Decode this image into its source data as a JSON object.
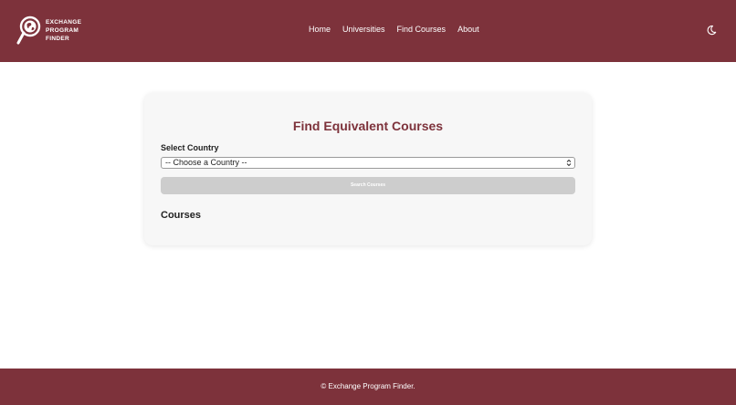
{
  "header": {
    "logo_lines": [
      "EXCHANGE",
      "PROGRAM",
      "FINDER"
    ],
    "nav": [
      "Home",
      "Universities",
      "Find Courses",
      "About"
    ],
    "theme_icon": "moon-icon"
  },
  "main": {
    "title": "Find Equivalent Courses",
    "country_label": "Select Country",
    "country_select_value": "-- Choose a Country --",
    "search_button": "Search Courses",
    "courses_heading": "Courses"
  },
  "footer": {
    "text": "© Exchange Program Finder."
  },
  "colors": {
    "brand": "#7d323b",
    "card_bg": "#f7f7f7",
    "button_disabled": "#cdcdcd"
  }
}
